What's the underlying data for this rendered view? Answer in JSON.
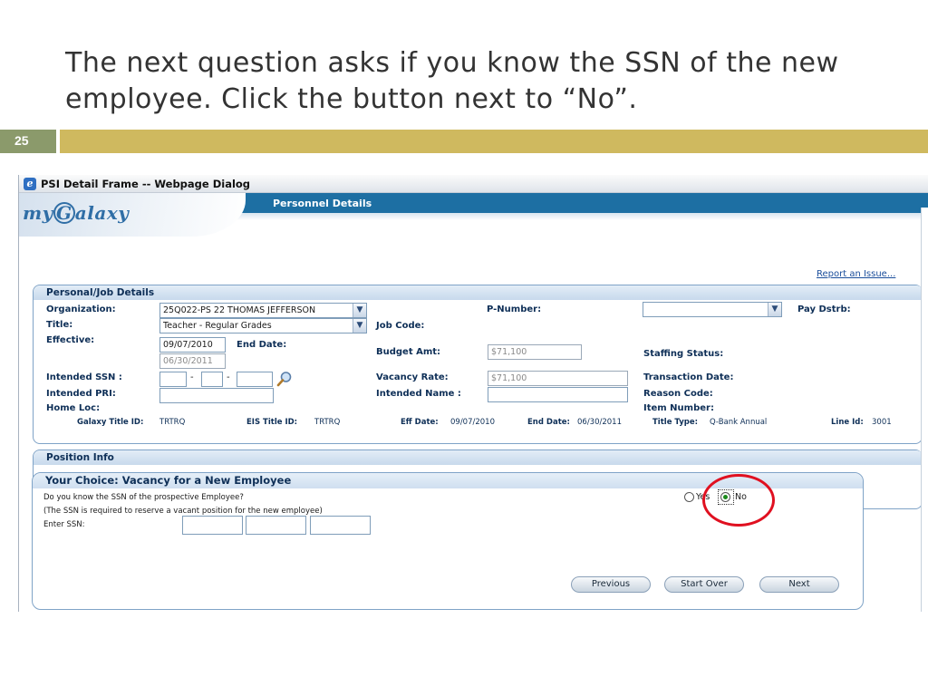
{
  "slide": {
    "title": "The next question asks if you know the SSN of the new employee.  Click the button next to “No”.",
    "number": "25"
  },
  "dialog": {
    "window_title": "PSI Detail Frame -- Webpage Dialog",
    "logo_text": "my",
    "logo_g": "G",
    "logo_rest": "alaxy",
    "header_title": "Personnel Details",
    "report_link": "Report an Issue..."
  },
  "personal": {
    "heading": "Personal/Job Details",
    "organization_label": "Organization:",
    "organization_value": "25Q022-PS 22 THOMAS JEFFERSON",
    "title_label": "Title:",
    "title_value": "Teacher - Regular Grades",
    "effective_label": "Effective:",
    "effective_value": "09/07/2010",
    "end_date_label": "End Date:",
    "end_date_value": "06/30/2011",
    "intended_ssn_label": "Intended SSN :",
    "intended_pri_label": "Intended PRI:",
    "home_loc_label": "Home Loc:",
    "pnumber_label": "P-Number:",
    "job_code_label": "Job Code:",
    "budget_amt_label": "Budget Amt:",
    "budget_amt_value": "$71,100",
    "vacancy_rate_label": "Vacancy Rate:",
    "vacancy_rate_value": "$71,100",
    "intended_name_label": "Intended Name :",
    "pay_dstrb_label": "Pay Dstrb:",
    "staffing_status_label": "Staffing Status:",
    "transaction_date_label": "Transaction Date:",
    "reason_code_label": "Reason Code:",
    "item_number_label": "Item Number:",
    "summary": {
      "galaxy_title_id_label": "Galaxy Title ID:",
      "galaxy_title_id": "TRTRQ",
      "eis_title_id_label": "EIS Title ID:",
      "eis_title_id": "TRTRQ",
      "eff_date_label": "Eff Date:",
      "eff_date": "09/07/2010",
      "end_date_label": "End Date:",
      "end_date": "06/30/2011",
      "title_type_label": "Title Type:",
      "title_type": "Q-Bank Annual",
      "line_id_label": "Line Id:",
      "line_id": "3001"
    }
  },
  "position": {
    "heading": "Position Info"
  },
  "choice": {
    "heading": "Your Choice: Vacancy for a New Employee",
    "question": "Do you know the SSN of the prospective Employee?",
    "note": "(The SSN is required to reserve a vacant position for the new employee)",
    "enter_ssn_label": "Enter SSN:",
    "yes_label": "Yes",
    "no_label": "No",
    "selected": "No",
    "previous_button": "Previous",
    "start_over_button": "Start Over",
    "next_button": "Next"
  },
  "colors": {
    "slide_number_bg": "#8b9a6b",
    "slide_bar": "#cfb95f",
    "banner_blue": "#1d6fa3",
    "label_navy": "#0e2f57",
    "highlight_red": "#e01020"
  }
}
